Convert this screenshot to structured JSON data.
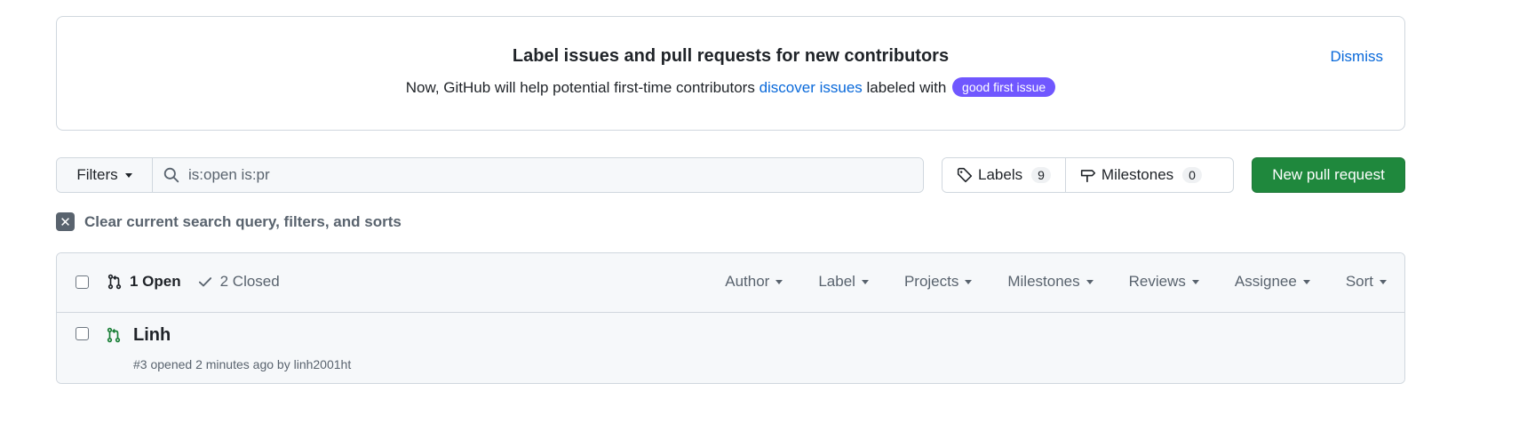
{
  "banner": {
    "title": "Label issues and pull requests for new contributors",
    "text_before": "Now, GitHub will help potential first-time contributors",
    "link": "discover issues",
    "text_after": "labeled with",
    "label_pill": "good first issue",
    "dismiss": "Dismiss",
    "pill_color": "#7057ff"
  },
  "toolbar": {
    "filters_label": "Filters",
    "search_value": "is:open is:pr",
    "labels_label": "Labels",
    "labels_count": "9",
    "milestones_label": "Milestones",
    "milestones_count": "0",
    "new_pr_label": "New pull request",
    "new_pr_color": "#1f883d"
  },
  "clear_query": "Clear current search query, filters, and sorts",
  "list": {
    "open_label": "1 Open",
    "closed_label": "2 Closed",
    "filters": [
      "Author",
      "Label",
      "Projects",
      "Milestones",
      "Reviews",
      "Assignee",
      "Sort"
    ],
    "items": [
      {
        "title": "Linh",
        "number": "#3",
        "opened": "opened 2 minutes ago by",
        "author": "linh2001ht",
        "status_color": "#1a7f37"
      }
    ]
  }
}
